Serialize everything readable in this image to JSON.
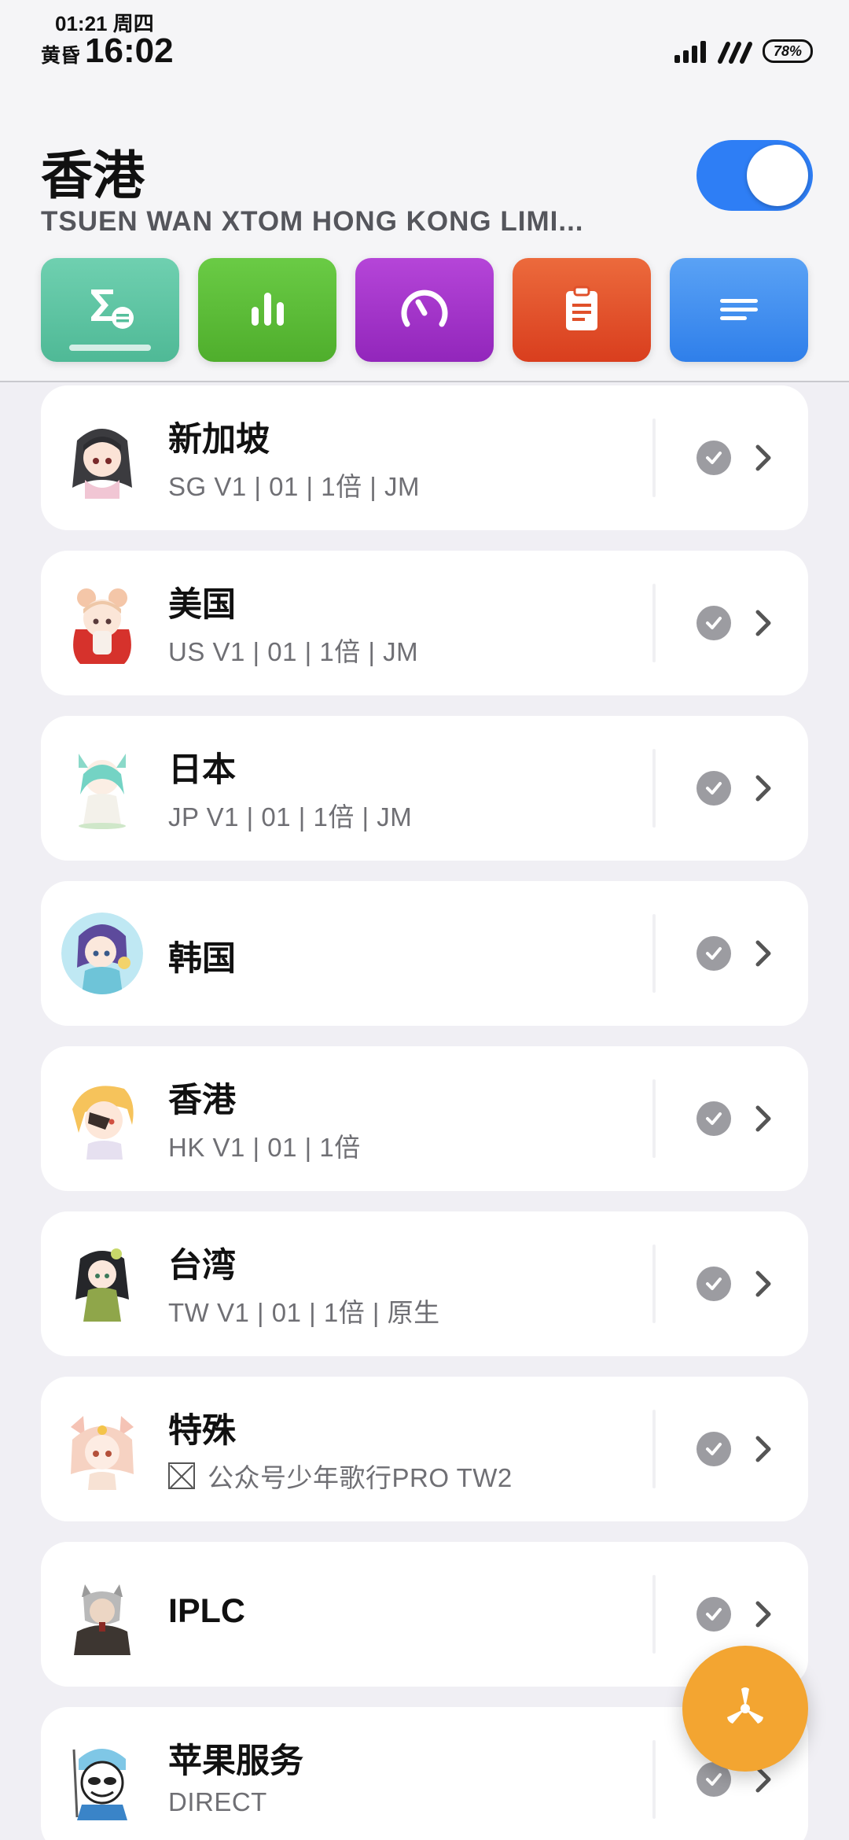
{
  "status_bar": {
    "small_line": "01:21 周四",
    "dusk_label": "黄昏",
    "time": "16:02",
    "battery": "78%"
  },
  "header": {
    "title": "香港",
    "subtitle": "TSUEN WAN XTOM HONG KONG LIMI...",
    "toggle_on": true
  },
  "tabs": [
    {
      "icon": "sum-icon",
      "color": "#5cc6a4",
      "selected": true
    },
    {
      "icon": "bar-chart-icon",
      "color": "#5cbb3a"
    },
    {
      "icon": "speedometer-icon",
      "color": "#a236c9"
    },
    {
      "icon": "clipboard-icon",
      "color": "#e4512e"
    },
    {
      "icon": "menu-lines-icon",
      "color": "#3d8ef0"
    }
  ],
  "groups": [
    {
      "title": "新加坡",
      "subtitle": "SG V1 | 01 | 1倍 | JM"
    },
    {
      "title": "美国",
      "subtitle": "US V1 | 01 | 1倍 | JM"
    },
    {
      "title": "日本",
      "subtitle": "JP V1 | 01 | 1倍 | JM"
    },
    {
      "title": "韩国",
      "subtitle": ""
    },
    {
      "title": "香港",
      "subtitle": "HK V1 | 01 | 1倍"
    },
    {
      "title": "台湾",
      "subtitle": "TW V1 | 01 | 1倍 | 原生"
    },
    {
      "title": "特殊",
      "subtitle": "公众号少年歌行PRO TW2"
    },
    {
      "title": "IPLC",
      "subtitle": ""
    },
    {
      "title": "苹果服务",
      "subtitle": "DIRECT"
    }
  ],
  "fab": {
    "icon": "propeller-icon",
    "color": "#f3a531"
  }
}
